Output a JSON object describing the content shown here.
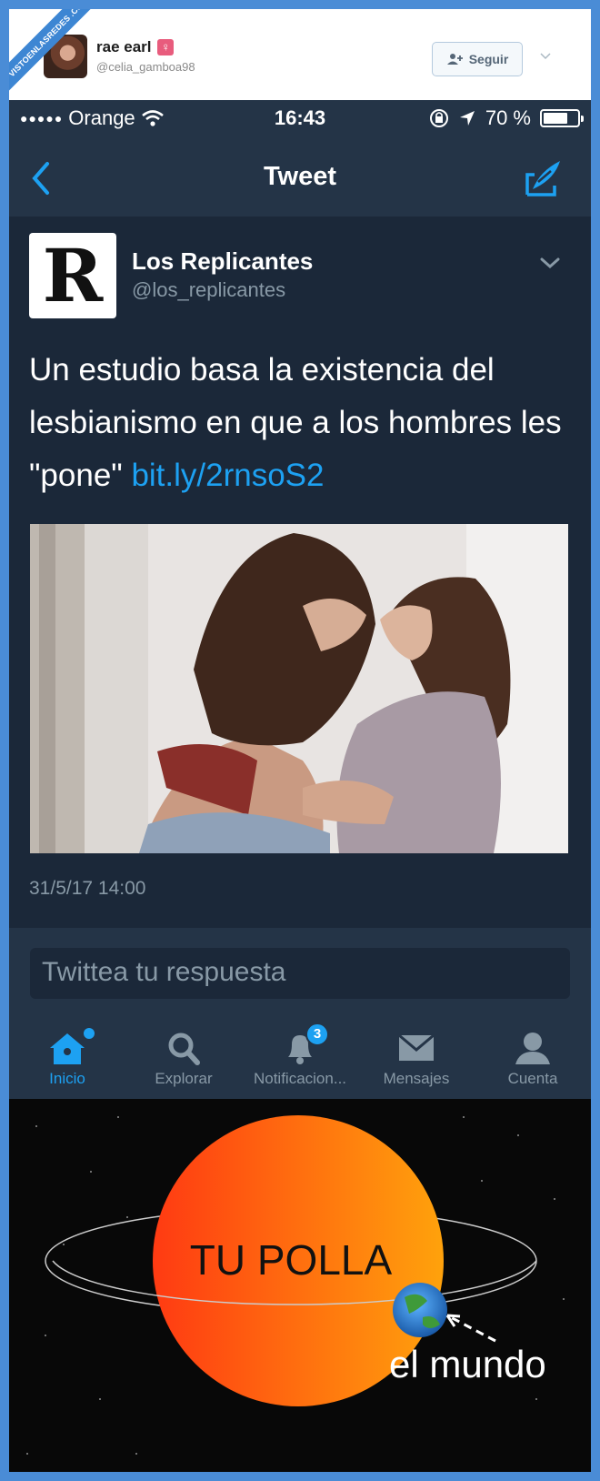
{
  "watermark": "VISTOENLASREDES .COM",
  "embed": {
    "user_name": "rae earl",
    "user_handle": "@celia_gamboa98",
    "follow_label": "Seguir",
    "accent": "#1da1f2"
  },
  "status_bar": {
    "signal": "●●●●●",
    "carrier": "Orange",
    "time": "16:43",
    "battery": "70 %"
  },
  "nav": {
    "title": "Tweet"
  },
  "tweet": {
    "avatar_letter": "R",
    "name": "Los Replicantes",
    "handle": "@los_replicantes",
    "text": "Un estudio basa la existencia del lesbianismo en que a los hombres les \"pone\" ",
    "link": "bit.ly/2rnsoS2",
    "date": "31/5/17 14:00"
  },
  "reply": {
    "placeholder": "Twittea tu respuesta"
  },
  "tabs": [
    {
      "label": "Inicio",
      "icon": "home-icon",
      "active": true
    },
    {
      "label": "Explorar",
      "icon": "search-icon"
    },
    {
      "label": "Notificacion...",
      "icon": "bell-icon",
      "badge": "3"
    },
    {
      "label": "Mensajes",
      "icon": "mail-icon"
    },
    {
      "label": "Cuenta",
      "icon": "person-icon"
    }
  ],
  "meme": {
    "center_label": "TU POLLA",
    "planet_label": "el mundo"
  }
}
